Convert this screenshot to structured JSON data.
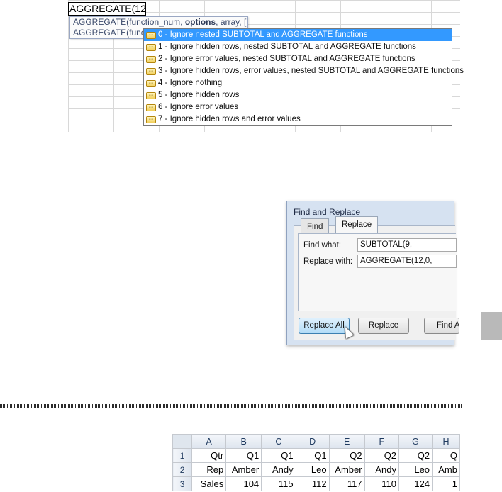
{
  "top": {
    "cell_text": "AGGREGATE(12",
    "tooltip_lines": [
      {
        "pre": "AGGREGATE(function_num, ",
        "bold": "options",
        "post": ", array, [k])"
      },
      {
        "pre": "AGGREGATE(funct",
        "bold": "",
        "post": ""
      }
    ],
    "dropdown_items": [
      "0 - Ignore nested SUBTOTAL and AGGREGATE functions",
      "1 - Ignore hidden rows, nested SUBTOTAL and AGGREGATE functions",
      "2 - Ignore error values, nested SUBTOTAL and AGGREGATE functions",
      "3 - Ignore hidden rows, error values, nested SUBTOTAL and AGGREGATE functions",
      "4 - Ignore nothing",
      "5 - Ignore hidden rows",
      "6 - Ignore error values",
      "7 - Ignore hidden rows and error values"
    ],
    "selected_index": 0
  },
  "dialog": {
    "title": "Find and Replace",
    "tab_find": "Find",
    "tab_replace": "Replace",
    "find_label": "Find what:",
    "find_value": "SUBTOTAL(9,",
    "replace_label": "Replace with:",
    "replace_value": "AGGREGATE(12,0,",
    "btn_replace_all": "Replace All",
    "btn_replace": "Replace",
    "btn_find_all": "Find A"
  },
  "sheet": {
    "columns": [
      "A",
      "B",
      "C",
      "D",
      "E",
      "F",
      "G",
      "H"
    ],
    "rows": [
      {
        "num": "1",
        "cells": [
          "Qtr",
          "Q1",
          "Q1",
          "Q1",
          "Q2",
          "Q2",
          "Q2",
          "Q"
        ]
      },
      {
        "num": "2",
        "cells": [
          "Rep",
          "Amber",
          "Andy",
          "Leo",
          "Amber",
          "Andy",
          "Leo",
          "Amb"
        ]
      },
      {
        "num": "3",
        "cells": [
          "Sales",
          "104",
          "115",
          "112",
          "117",
          "110",
          "124",
          "1"
        ]
      }
    ]
  }
}
